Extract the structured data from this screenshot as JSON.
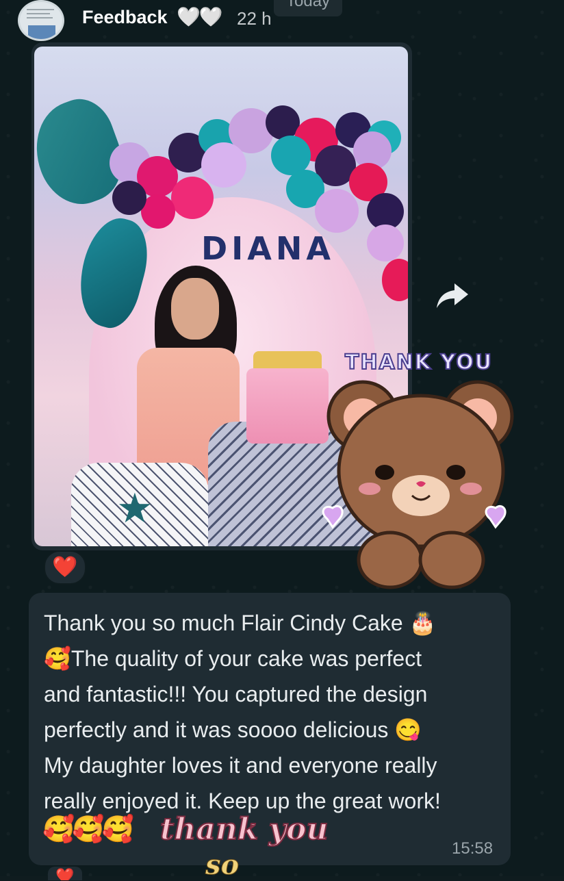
{
  "header": {
    "title": "Feedback",
    "title_hearts": "🤍🤍",
    "time_ago": "22 h",
    "date_chip": "Today"
  },
  "image_message": {
    "banner_name": "DIANA",
    "reaction": "❤️"
  },
  "sticker": {
    "caption": "THANK YOU"
  },
  "text_message": {
    "line1": "Thank you so much Flair Cindy Cake 🎂",
    "line2": "🥰The quality of your cake was perfect",
    "line3": "and fantastic!!! You captured the design",
    "line4": "perfectly and it was soooo delicious 😋",
    "line5": "My daughter loves it and everyone really",
    "line6": "really enjoyed it. Keep up the great work!",
    "emojis": "🥰🥰🥰",
    "sticker_text": "thank you",
    "sticker_text2": "so",
    "timestamp": "15:58"
  },
  "next_reaction": "❤️",
  "colors": {
    "background": "#0d1b1e",
    "bubble": "#1f2c33",
    "text": "#e9edef",
    "meta": "#9aa5ab",
    "heart": "#e3243b"
  }
}
